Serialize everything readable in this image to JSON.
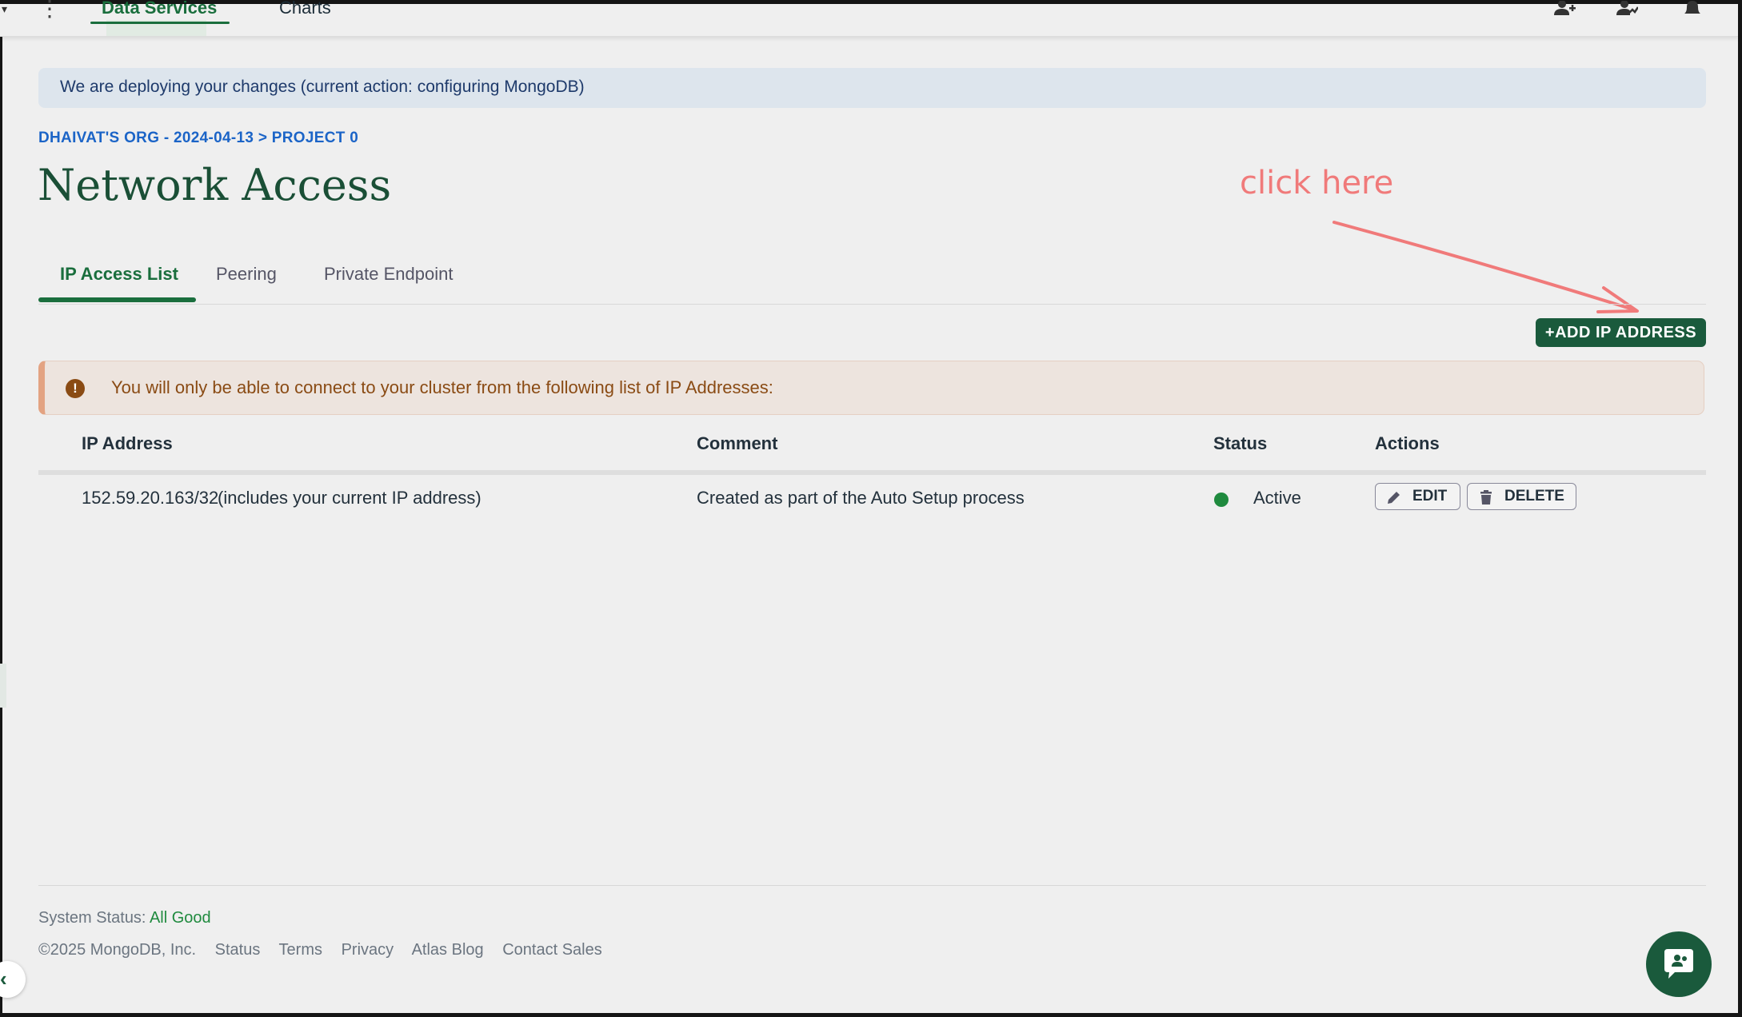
{
  "topnav": {
    "tabs": [
      {
        "label": "Data Services"
      },
      {
        "label": "Charts"
      }
    ]
  },
  "deploy_banner": {
    "text": "We are deploying your changes (current action: configuring MongoDB)"
  },
  "breadcrumb": "DHAIVAT'S ORG - 2024-04-13 > PROJECT 0",
  "page_title": "Network Access",
  "annotation": {
    "text": "click here",
    "color": "#f07a7a"
  },
  "subtabs": [
    {
      "label": "IP Access List"
    },
    {
      "label": "Peering"
    },
    {
      "label": "Private Endpoint"
    }
  ],
  "add_ip_button": "+ADD IP ADDRESS",
  "warning": {
    "text": "You will only be able to connect to your cluster from the following list of IP Addresses:",
    "icon": "exclamation-icon"
  },
  "table": {
    "headers": [
      "IP Address",
      "Comment",
      "Status",
      "Actions"
    ],
    "rows": [
      {
        "ip": "152.59.20.163/32",
        "ip_note": "(includes your current IP address)",
        "comment": "Created as part of the Auto Setup process",
        "status": "Active",
        "actions": [
          "EDIT",
          "DELETE"
        ]
      }
    ]
  },
  "footer": {
    "system_status_label": "System Status:",
    "system_status_value": "All Good",
    "copyright": "©2025 MongoDB, Inc.",
    "links": [
      "Status",
      "Terms",
      "Privacy",
      "Atlas Blog",
      "Contact Sales"
    ]
  },
  "colors": {
    "brand_green": "#1a5a3c",
    "active_tab": "#1a6e3d",
    "link_blue": "#1b64c7",
    "status_active": "#1f8a3e",
    "warning_text": "#8a4b14"
  }
}
